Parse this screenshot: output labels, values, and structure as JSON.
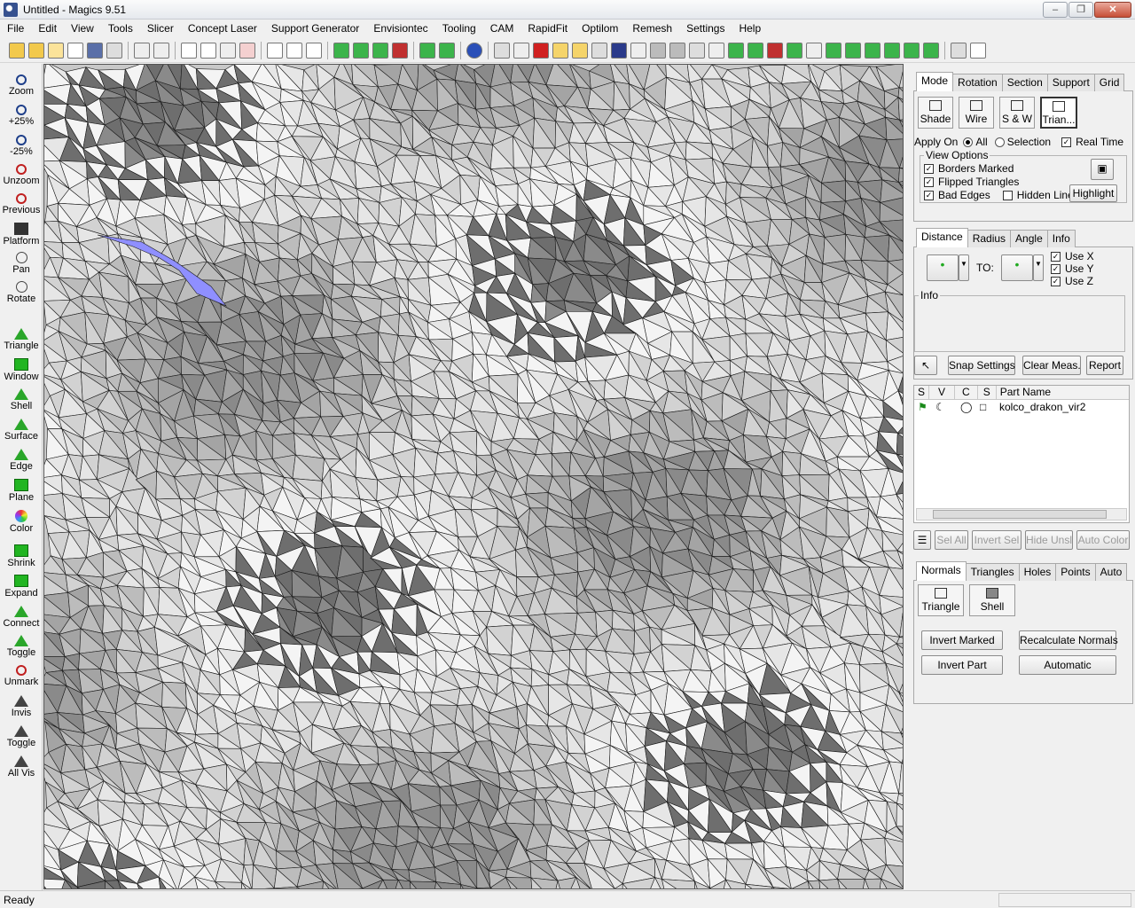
{
  "window": {
    "title": "Untitled - Magics 9.51"
  },
  "menu": [
    "File",
    "Edit",
    "View",
    "Tools",
    "Slicer",
    "Concept Laser",
    "Support Generator",
    "Envisiontec",
    "Tooling",
    "CAM",
    "RapidFit",
    "Optilom",
    "Remesh",
    "Settings",
    "Help"
  ],
  "left_tools": [
    "Zoom",
    "+25%",
    "-25%",
    "Unzoom",
    "Previous",
    "Platform",
    "Pan",
    "Rotate",
    "Triangle",
    "Window",
    "Shell",
    "Surface",
    "Edge",
    "Plane",
    "Color",
    "Shrink",
    "Expand",
    "Connect",
    "Toggle",
    "Unmark",
    "Invis",
    "Toggle",
    "All Vis"
  ],
  "view_panel": {
    "tabs": [
      "Mode",
      "Rotation",
      "Section",
      "Support",
      "Grid"
    ],
    "active_tab": "Mode",
    "modes": [
      "Shade",
      "Wire",
      "S & W",
      "Trian..."
    ],
    "active_mode": "Trian...",
    "apply_on_label": "Apply On",
    "apply_all": "All",
    "apply_selection": "Selection",
    "real_time": "Real Time",
    "view_options_label": "View Options",
    "borders_marked": "Borders Marked",
    "flipped_triangles": "Flipped Triangles",
    "bad_edges": "Bad Edges",
    "hidden_line": "Hidden Line",
    "highlight": "Highlight"
  },
  "measure_panel": {
    "tabs": [
      "Distance",
      "Radius",
      "Angle",
      "Info"
    ],
    "active_tab": "Distance",
    "to_label": "TO:",
    "use_x": "Use X",
    "use_y": "Use Y",
    "use_z": "Use Z",
    "info_label": "Info",
    "snap_settings": "Snap Settings",
    "clear_meas": "Clear Meas.",
    "report": "Report"
  },
  "parts": {
    "columns": [
      "S",
      "V",
      "C",
      "S",
      "Part Name"
    ],
    "rows": [
      {
        "name": "kolco_drakon_vir2"
      }
    ],
    "buttons": [
      "Sel All",
      "Invert Sel",
      "Hide Unsl",
      "Auto Color"
    ]
  },
  "fix_panel": {
    "tabs": [
      "Normals",
      "Triangles",
      "Holes",
      "Points",
      "Auto"
    ],
    "active_tab": "Normals",
    "tools": [
      "Triangle",
      "Shell"
    ],
    "invert_marked": "Invert Marked",
    "recalculate_normals": "Recalculate Normals",
    "invert_part": "Invert Part",
    "automatic": "Automatic"
  },
  "status": {
    "text": "Ready"
  },
  "colors": {
    "mesh_fill": "#c8c8c8",
    "mesh_line": "#1a1a1a",
    "selected": "#8f8fff"
  }
}
